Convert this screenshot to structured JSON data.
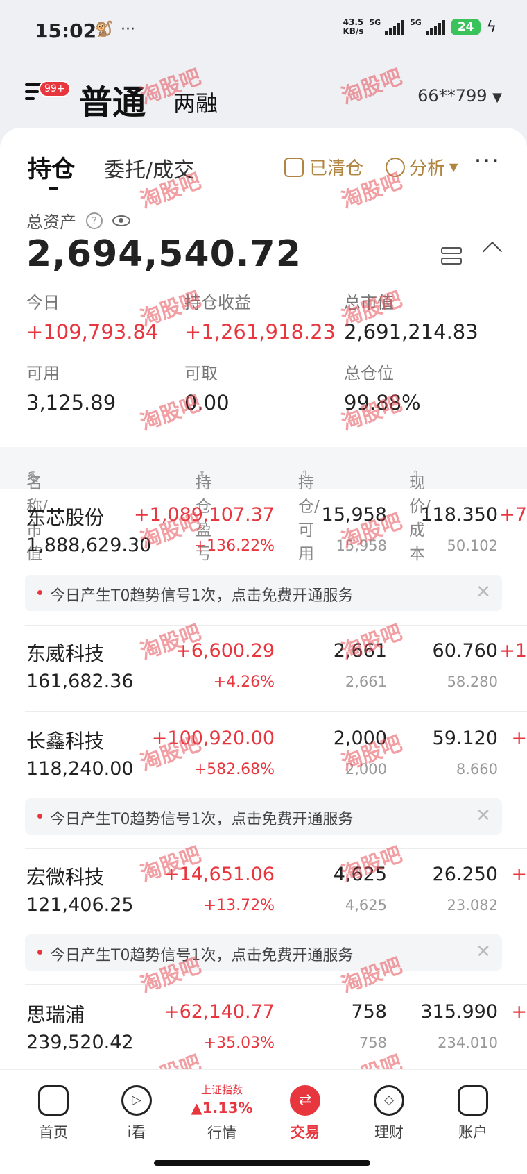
{
  "status": {
    "time": "15:02",
    "net_speed_top": "43.5",
    "net_speed_bottom": "KB/s",
    "sig1": "5G",
    "sig2": "5G",
    "battery": "24"
  },
  "header": {
    "menu_badge": "99+",
    "tab_normal": "普通",
    "tab_margin": "两融",
    "account_id": "66**799"
  },
  "tabs": {
    "holdings": "持仓",
    "orders": "委托/成交",
    "cleared": "已清仓",
    "analysis": "分析",
    "more": "···"
  },
  "assets": {
    "total_label": "总资产",
    "total_value": "2,694,540.72",
    "today_label": "今日",
    "today_value": "+109,793.84",
    "holding_pl_label": "持仓收益",
    "holding_pl_value": "+1,261,918.23",
    "market_value_label": "总市值",
    "market_value_value": "2,691,214.83",
    "available_label": "可用",
    "available_value": "3,125.89",
    "withdrawable_label": "可取",
    "withdrawable_value": "0.00",
    "position_label": "总仓位",
    "position_value": "99.88%"
  },
  "table": {
    "col_name": "名称/市值",
    "col_pl": "持仓盈亏",
    "col_qty": "持仓/可用",
    "col_price": "现价/成本",
    "rows": [
      {
        "name": "东芯股份",
        "mv": "1,888,629.30",
        "pl": "+1,089,107.37",
        "plp": "+136.22%",
        "qty": "15,958",
        "avail": "15,958",
        "price": "118.350",
        "cost": "50.102",
        "trunc": "+7"
      },
      {
        "name": "东威科技",
        "mv": "161,682.36",
        "pl": "+6,600.29",
        "plp": "+4.26%",
        "qty": "2,661",
        "avail": "2,661",
        "price": "60.760",
        "cost": "58.280",
        "trunc": "+1"
      },
      {
        "name": "长鑫科技",
        "mv": "118,240.00",
        "pl": "+100,920.00",
        "plp": "+582.68%",
        "qty": "2,000",
        "avail": "2,000",
        "price": "59.120",
        "cost": "8.660",
        "trunc": "+"
      },
      {
        "name": "宏微科技",
        "mv": "121,406.25",
        "pl": "+14,651.06",
        "plp": "+13.72%",
        "qty": "4,625",
        "avail": "4,625",
        "price": "26.250",
        "cost": "23.082",
        "trunc": "+"
      },
      {
        "name": "思瑞浦",
        "mv": "239,520.42",
        "pl": "+62,140.77",
        "plp": "+35.03%",
        "qty": "758",
        "avail": "758",
        "price": "315.990",
        "cost": "234.010",
        "trunc": "+"
      }
    ],
    "signal_text": "今日产生T0趋势信号1次，点击免费开通服务"
  },
  "watermark": "淘股吧",
  "nav": {
    "home": "首页",
    "watch": "i看",
    "market_index_name": "上证指数",
    "market_index_change": "▲1.13%",
    "market": "行情",
    "trade": "交易",
    "wealth": "理财",
    "account": "账户"
  }
}
